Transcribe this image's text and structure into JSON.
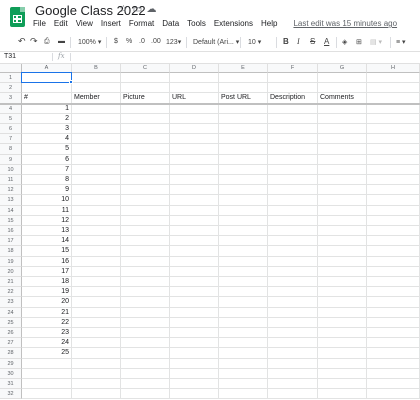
{
  "app": {
    "doc_title": "Google Class 2022",
    "icons": [
      "star-icon",
      "folder-icon",
      "cloud-icon"
    ],
    "menus": [
      "File",
      "Edit",
      "View",
      "Insert",
      "Format",
      "Data",
      "Tools",
      "Extensions",
      "Help"
    ],
    "last_edit": "Last edit was 15 minutes ago"
  },
  "toolbar": {
    "zoom": "100%",
    "currency": "$",
    "percent": "%",
    "decimal_decrease": ".0",
    "decimal_increase": ".00",
    "format_more": "123",
    "font": "Default (Ari...",
    "font_size": "10",
    "bold": "B",
    "italic": "I",
    "strike": "S",
    "text_color": "A"
  },
  "formula_bar": {
    "name_box": "T31",
    "fx": "fx",
    "value": ""
  },
  "sheet": {
    "columns": [
      "A",
      "B",
      "C",
      "D",
      "E",
      "F",
      "G",
      "H"
    ],
    "header_row": [
      "#",
      "Member",
      "Picture",
      "URL",
      "Post URL",
      "Description",
      "Comments",
      ""
    ],
    "rows": [
      "1",
      "2",
      "3",
      "4",
      "5",
      "6",
      "7",
      "8",
      "9",
      "10",
      "11",
      "12",
      "13",
      "14",
      "15",
      "16",
      "17",
      "18",
      "19",
      "20",
      "21",
      "22",
      "23",
      "24",
      "25",
      "26",
      "27",
      "28",
      "29",
      "30",
      "31",
      "32"
    ],
    "numbers": [
      "1",
      "2",
      "3",
      "4",
      "5",
      "6",
      "7",
      "8",
      "9",
      "10",
      "11",
      "12",
      "13",
      "14",
      "15",
      "16",
      "17",
      "18",
      "19",
      "20",
      "21",
      "22",
      "23",
      "24",
      "25"
    ],
    "selected_cell": "A1"
  },
  "colors": {
    "logo": "#0f9d58",
    "selection": "#1a73e8",
    "header_bg": "#f8f9fa"
  }
}
